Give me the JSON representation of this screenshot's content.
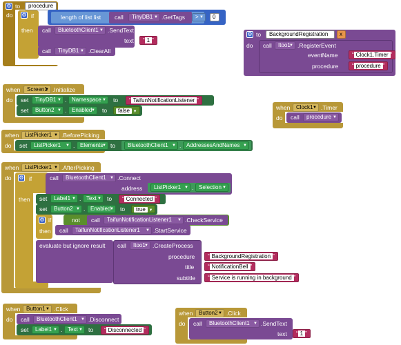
{
  "colors": {
    "procedure": "#a67f1c",
    "control": "#c4a235",
    "method": "#7a4a93",
    "setter": "#2e7041",
    "math": "#3563c4",
    "text": "#b32d5e",
    "logic": "#5a8e2c",
    "event": "#b89838"
  },
  "icons": [
    "gear-icon",
    "dropdown-arrow-icon",
    "close-icon"
  ],
  "proc": {
    "to": "to",
    "name": "procedure",
    "do": "do",
    "if": "if",
    "then": "then",
    "length_label": "length of list list",
    "call": "call",
    "tinydb": "TinyDB1",
    "gettags": ".GetTags",
    "op": ">",
    "zero": "0",
    "bt": "BluetoothClient1",
    "sendtext": ".SendText",
    "text": "text",
    "one": "1",
    "cleartinydb": "TinyDB1",
    "clearall": ".ClearAll"
  },
  "bgreg": {
    "to": "to",
    "name": "BackgroundRegistration",
    "do": "do",
    "call": "call",
    "comp": "Itoo1",
    "method": ".RegisterEvent",
    "eventName": "eventName",
    "eventValue": "Clock1.Timer",
    "procedure_label": "procedure",
    "procedure_value": "procedure"
  },
  "screen": {
    "when": "when",
    "comp": "Screen1",
    "event": ".Initialize",
    "do": "do",
    "set": "set",
    "tinydb": "TinyDB1",
    "namespace": "Namespace",
    "to": "to",
    "ns_value": "TaifunNotificationListener",
    "button": "Button2",
    "enabled": "Enabled",
    "false": "false"
  },
  "clock": {
    "when": "when",
    "comp": "Clock1",
    "event": ".Timer",
    "do": "do",
    "call": "call",
    "proc": "procedure"
  },
  "before": {
    "when": "when",
    "comp": "ListPicker1",
    "event": ".BeforePicking",
    "do": "do",
    "set": "set",
    "lp": "ListPicker1",
    "elements": "Elements",
    "to": "to",
    "bt": "BluetoothClient1",
    "addresses": "AddressesAndNames"
  },
  "after": {
    "when": "when",
    "comp": "ListPicker1",
    "event": ".AfterPicking",
    "do": "do",
    "if": "if",
    "call": "call",
    "bt": "BluetoothClient1",
    "connect": ".Connect",
    "address": "address",
    "lp": "ListPicker1",
    "selection": "Selection",
    "then": "then",
    "set": "set",
    "label": "Label1",
    "textprop": "Text",
    "to": "to",
    "connected": "Connected",
    "button": "Button2",
    "enabled": "Enabled",
    "true": "true",
    "not": "not",
    "tnl": "TaifunNotificationListener1",
    "check": ".CheckService",
    "start": ".StartService",
    "evalignore": "evaluate but ignore result",
    "itoo": "Itoo1",
    "create": ".CreateProcess",
    "procedure": "procedure",
    "bgreg": "BackgroundRegistration",
    "title": "title",
    "notif": "NotificationBell",
    "subtitle": "subtitle",
    "running": "Service is running in background"
  },
  "b1": {
    "when": "when",
    "comp": "Button1",
    "event": ".Click",
    "do": "do",
    "call": "call",
    "bt": "BluetoothClient1",
    "disconnect": ".Disconnect",
    "set": "set",
    "label": "Label1",
    "textprop": "Text",
    "to": "to",
    "disc": "Disconnected"
  },
  "b2": {
    "when": "when",
    "comp": "Button2",
    "event": ".Click",
    "do": "do",
    "call": "call",
    "bt": "BluetoothClient1",
    "send": ".SendText",
    "text": "text",
    "one": "1"
  }
}
